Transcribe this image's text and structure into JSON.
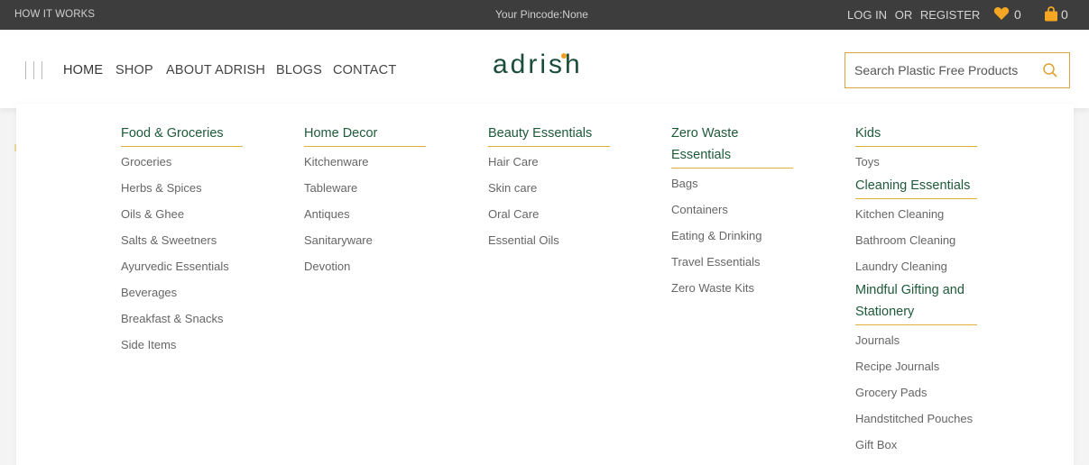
{
  "topbar": {
    "how_it_works": "HOW IT WORKS",
    "pincode": "Your Pincode:None",
    "login": "LOG IN",
    "or": "OR",
    "register": "REGISTER",
    "wishlist_count": "0",
    "cart_count": "0"
  },
  "nav": {
    "items": [
      "HOME",
      "SHOP",
      "ABOUT ADRISH",
      "BLOGS",
      "CONTACT"
    ]
  },
  "logo": {
    "text": "adrish"
  },
  "search": {
    "placeholder": "Search Plastic Free Products"
  },
  "menu": {
    "col1": {
      "heading": "Food & Groceries",
      "items": [
        "Groceries",
        "Herbs & Spices",
        "Oils & Ghee",
        "Salts & Sweetners",
        "Ayurvedic Essentials",
        "Beverages",
        "Breakfast & Snacks",
        "Side Items"
      ]
    },
    "col2": {
      "heading": "Home Decor",
      "items": [
        "Kitchenware",
        "Tableware",
        "Antiques",
        "Sanitaryware",
        "Devotion"
      ]
    },
    "col3": {
      "heading": "Beauty Essentials",
      "items": [
        "Hair Care",
        "Skin care",
        "Oral Care",
        "Essential Oils"
      ]
    },
    "col4": {
      "heading_line1": "Zero Waste",
      "heading_line2": "Essentials",
      "items": [
        "Bags",
        "Containers",
        "Eating & Drinking",
        "Travel Essentials",
        "Zero Waste Kits"
      ]
    },
    "col5": {
      "kids": {
        "heading": "Kids",
        "items": [
          "Toys"
        ]
      },
      "cleaning": {
        "heading": "Cleaning Essentials",
        "items": [
          "Kitchen Cleaning",
          "Bathroom Cleaning",
          "Laundry Cleaning"
        ]
      },
      "gifting": {
        "heading_line1": "Mindful Gifting and",
        "heading_line2": "Stationery",
        "items": [
          "Journals",
          "Recipe Journals",
          "Grocery Pads",
          "Handstitched Pouches",
          "Gift Box"
        ]
      }
    }
  },
  "colors": {
    "accent": "#e0b040",
    "heading_green": "#1e5a3a",
    "topbar_bg": "#3d3d3d",
    "icon_orange": "#f5a623"
  }
}
